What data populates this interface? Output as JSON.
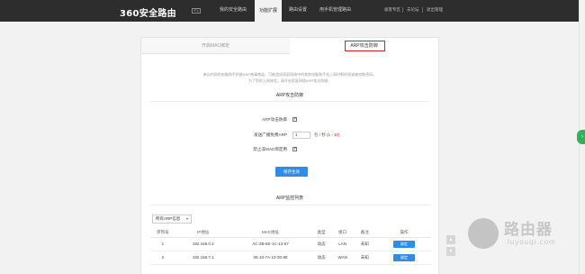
{
  "header": {
    "logo_text": "360安全路由",
    "logo_badge": "P1",
    "nav": [
      {
        "label": "我的安全路由"
      },
      {
        "label": "功能扩展"
      },
      {
        "label": "路由设置"
      },
      {
        "label": "用手机管理路由"
      }
    ],
    "right_links": [
      {
        "label": "极客专区"
      },
      {
        "label": "去论坛"
      },
      {
        "label": "退出管理"
      }
    ]
  },
  "tabs": {
    "left": "开启MAC绑定",
    "right": "ARP攻击防御"
  },
  "description": {
    "line1": "来自内网的电脑和手机被ARP病毒感染，可能造成家庭网络中的其他电脑和手机上网时断时续或被窃取密码。",
    "line2": "为了您的上网体验，请开启家庭网络ARP攻击防御。"
  },
  "arp_defense": {
    "title": "ARP攻击防御",
    "enable_label": "ARP攻击防御",
    "enable_checked": "✓",
    "broadcast_label": "发送广播免费ARP",
    "broadcast_value": "1",
    "broadcast_unit": "包 / 秒",
    "broadcast_range": "(1 - 10)",
    "block_label": "禁止非MAC绑定用",
    "block_checked": "✓",
    "save_label": "保存生效"
  },
  "arp_list": {
    "title": "ARP监控列表",
    "filter_selected": "所有ARP信息",
    "columns": [
      "序列号",
      "IP地址",
      "MAC地址",
      "类型",
      "接口",
      "备注",
      "操作"
    ],
    "rows": [
      {
        "index": "1",
        "ip": "192.168.0.2",
        "mac": "AC-2B-6E-1C-13-67",
        "type": "动态",
        "iface": "LAN",
        "note": "未知",
        "action": "绑定"
      },
      {
        "index": "2",
        "ip": "192.168.7.1",
        "mac": "08-10-7A-10-30-88",
        "type": "动态",
        "iface": "WAN",
        "note": "未知",
        "action": "绑定"
      }
    ]
  },
  "watermark": {
    "title": "路由器",
    "subtitle": "luyouqi.com"
  }
}
